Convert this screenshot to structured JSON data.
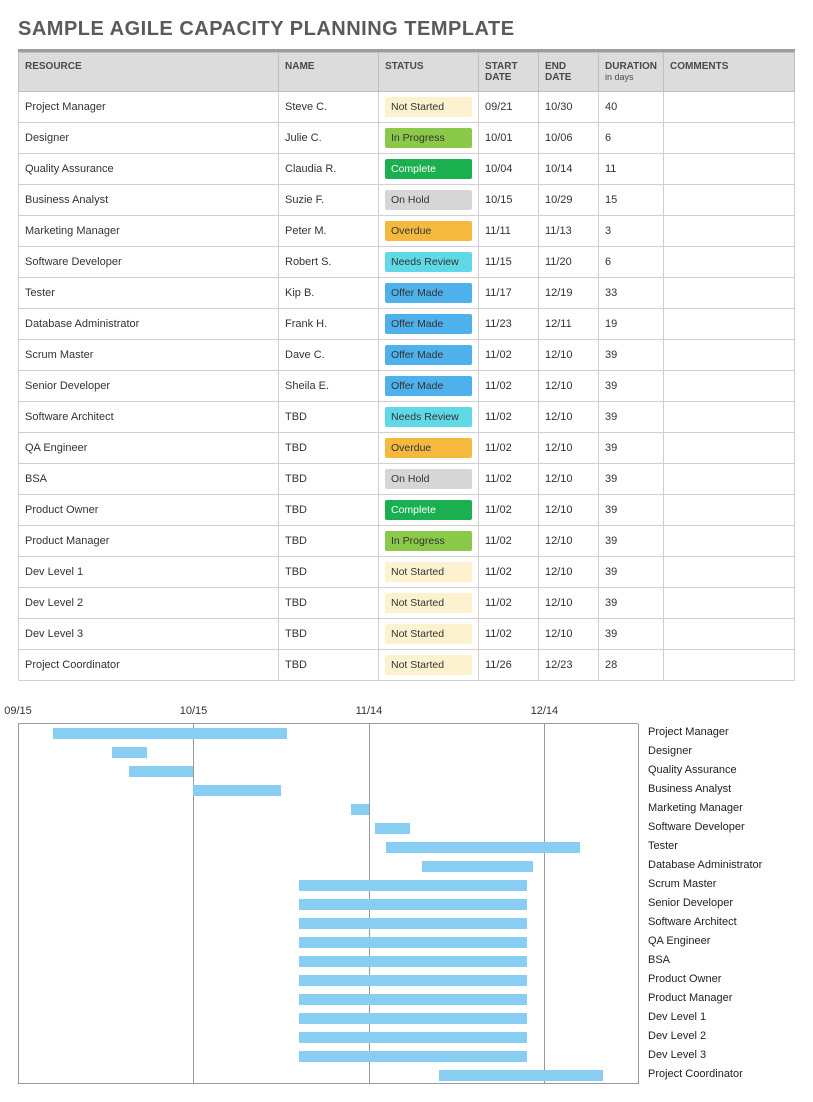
{
  "title": "SAMPLE AGILE CAPACITY PLANNING TEMPLATE",
  "columns": {
    "resource": "RESOURCE",
    "name": "NAME",
    "status": "STATUS",
    "start": "START DATE",
    "end": "END DATE",
    "duration": "DURATION",
    "duration_sub": "in days",
    "comments": "COMMENTS"
  },
  "status_styles": {
    "Not Started": "st-not-started",
    "In Progress": "st-in-progress",
    "Complete": "st-complete",
    "On Hold": "st-on-hold",
    "Overdue": "st-overdue",
    "Needs Review": "st-needs-review",
    "Offer Made": "st-offer-made"
  },
  "rows": [
    {
      "resource": "Project Manager",
      "name": "Steve C.",
      "status": "Not Started",
      "start": "09/21",
      "end": "10/30",
      "duration": "40",
      "comments": ""
    },
    {
      "resource": "Designer",
      "name": "Julie C.",
      "status": "In Progress",
      "start": "10/01",
      "end": "10/06",
      "duration": "6",
      "comments": ""
    },
    {
      "resource": "Quality Assurance",
      "name": "Claudia R.",
      "status": "Complete",
      "start": "10/04",
      "end": "10/14",
      "duration": "11",
      "comments": ""
    },
    {
      "resource": "Business Analyst",
      "name": "Suzie F.",
      "status": "On Hold",
      "start": "10/15",
      "end": "10/29",
      "duration": "15",
      "comments": ""
    },
    {
      "resource": "Marketing Manager",
      "name": "Peter M.",
      "status": "Overdue",
      "start": "11/11",
      "end": "11/13",
      "duration": "3",
      "comments": ""
    },
    {
      "resource": "Software Developer",
      "name": "Robert S.",
      "status": "Needs Review",
      "start": "11/15",
      "end": "11/20",
      "duration": "6",
      "comments": ""
    },
    {
      "resource": "Tester",
      "name": "Kip B.",
      "status": "Offer Made",
      "start": "11/17",
      "end": "12/19",
      "duration": "33",
      "comments": ""
    },
    {
      "resource": "Database Administrator",
      "name": "Frank H.",
      "status": "Offer Made",
      "start": "11/23",
      "end": "12/11",
      "duration": "19",
      "comments": ""
    },
    {
      "resource": "Scrum Master",
      "name": "Dave C.",
      "status": "Offer Made",
      "start": "11/02",
      "end": "12/10",
      "duration": "39",
      "comments": ""
    },
    {
      "resource": "Senior Developer",
      "name": "Sheila E.",
      "status": "Offer Made",
      "start": "11/02",
      "end": "12/10",
      "duration": "39",
      "comments": ""
    },
    {
      "resource": "Software Architect",
      "name": "TBD",
      "status": "Needs Review",
      "start": "11/02",
      "end": "12/10",
      "duration": "39",
      "comments": ""
    },
    {
      "resource": "QA Engineer",
      "name": "TBD",
      "status": "Overdue",
      "start": "11/02",
      "end": "12/10",
      "duration": "39",
      "comments": ""
    },
    {
      "resource": "BSA",
      "name": "TBD",
      "status": "On Hold",
      "start": "11/02",
      "end": "12/10",
      "duration": "39",
      "comments": ""
    },
    {
      "resource": "Product Owner",
      "name": "TBD",
      "status": "Complete",
      "start": "11/02",
      "end": "12/10",
      "duration": "39",
      "comments": ""
    },
    {
      "resource": "Product Manager",
      "name": "TBD",
      "status": "In Progress",
      "start": "11/02",
      "end": "12/10",
      "duration": "39",
      "comments": ""
    },
    {
      "resource": "Dev Level 1",
      "name": "TBD",
      "status": "Not Started",
      "start": "11/02",
      "end": "12/10",
      "duration": "39",
      "comments": ""
    },
    {
      "resource": "Dev Level 2",
      "name": "TBD",
      "status": "Not Started",
      "start": "11/02",
      "end": "12/10",
      "duration": "39",
      "comments": ""
    },
    {
      "resource": "Dev Level 3",
      "name": "TBD",
      "status": "Not Started",
      "start": "11/02",
      "end": "12/10",
      "duration": "39",
      "comments": ""
    },
    {
      "resource": "Project Coordinator",
      "name": "TBD",
      "status": "Not Started",
      "start": "11/26",
      "end": "12/23",
      "duration": "28",
      "comments": ""
    }
  ],
  "chart_data": {
    "type": "bar",
    "orientation": "horizontal-gantt",
    "x_axis": {
      "ticks": [
        "09/15",
        "10/15",
        "11/14",
        "12/14"
      ],
      "range_start": "09/15",
      "range_end": "12/30",
      "unit": "days",
      "total_days": 106
    },
    "series": [
      {
        "label": "Project Manager",
        "start": "09/21",
        "end": "10/30",
        "start_offset_days": 6,
        "duration_days": 40
      },
      {
        "label": "Designer",
        "start": "10/01",
        "end": "10/06",
        "start_offset_days": 16,
        "duration_days": 6
      },
      {
        "label": "Quality Assurance",
        "start": "10/04",
        "end": "10/14",
        "start_offset_days": 19,
        "duration_days": 11
      },
      {
        "label": "Business Analyst",
        "start": "10/15",
        "end": "10/29",
        "start_offset_days": 30,
        "duration_days": 15
      },
      {
        "label": "Marketing Manager",
        "start": "11/11",
        "end": "11/13",
        "start_offset_days": 57,
        "duration_days": 3
      },
      {
        "label": "Software Developer",
        "start": "11/15",
        "end": "11/20",
        "start_offset_days": 61,
        "duration_days": 6
      },
      {
        "label": "Tester",
        "start": "11/17",
        "end": "12/19",
        "start_offset_days": 63,
        "duration_days": 33
      },
      {
        "label": "Database Administrator",
        "start": "11/23",
        "end": "12/11",
        "start_offset_days": 69,
        "duration_days": 19
      },
      {
        "label": "Scrum Master",
        "start": "11/02",
        "end": "12/10",
        "start_offset_days": 48,
        "duration_days": 39
      },
      {
        "label": "Senior Developer",
        "start": "11/02",
        "end": "12/10",
        "start_offset_days": 48,
        "duration_days": 39
      },
      {
        "label": "Software Architect",
        "start": "11/02",
        "end": "12/10",
        "start_offset_days": 48,
        "duration_days": 39
      },
      {
        "label": "QA Engineer",
        "start": "11/02",
        "end": "12/10",
        "start_offset_days": 48,
        "duration_days": 39
      },
      {
        "label": "BSA",
        "start": "11/02",
        "end": "12/10",
        "start_offset_days": 48,
        "duration_days": 39
      },
      {
        "label": "Product Owner",
        "start": "11/02",
        "end": "12/10",
        "start_offset_days": 48,
        "duration_days": 39
      },
      {
        "label": "Product Manager",
        "start": "11/02",
        "end": "12/10",
        "start_offset_days": 48,
        "duration_days": 39
      },
      {
        "label": "Dev Level 1",
        "start": "11/02",
        "end": "12/10",
        "start_offset_days": 48,
        "duration_days": 39
      },
      {
        "label": "Dev Level 2",
        "start": "11/02",
        "end": "12/10",
        "start_offset_days": 48,
        "duration_days": 39
      },
      {
        "label": "Dev Level 3",
        "start": "11/02",
        "end": "12/10",
        "start_offset_days": 48,
        "duration_days": 39
      },
      {
        "label": "Project Coordinator",
        "start": "11/26",
        "end": "12/23",
        "start_offset_days": 72,
        "duration_days": 28
      }
    ],
    "bar_color": "#87cef2"
  }
}
